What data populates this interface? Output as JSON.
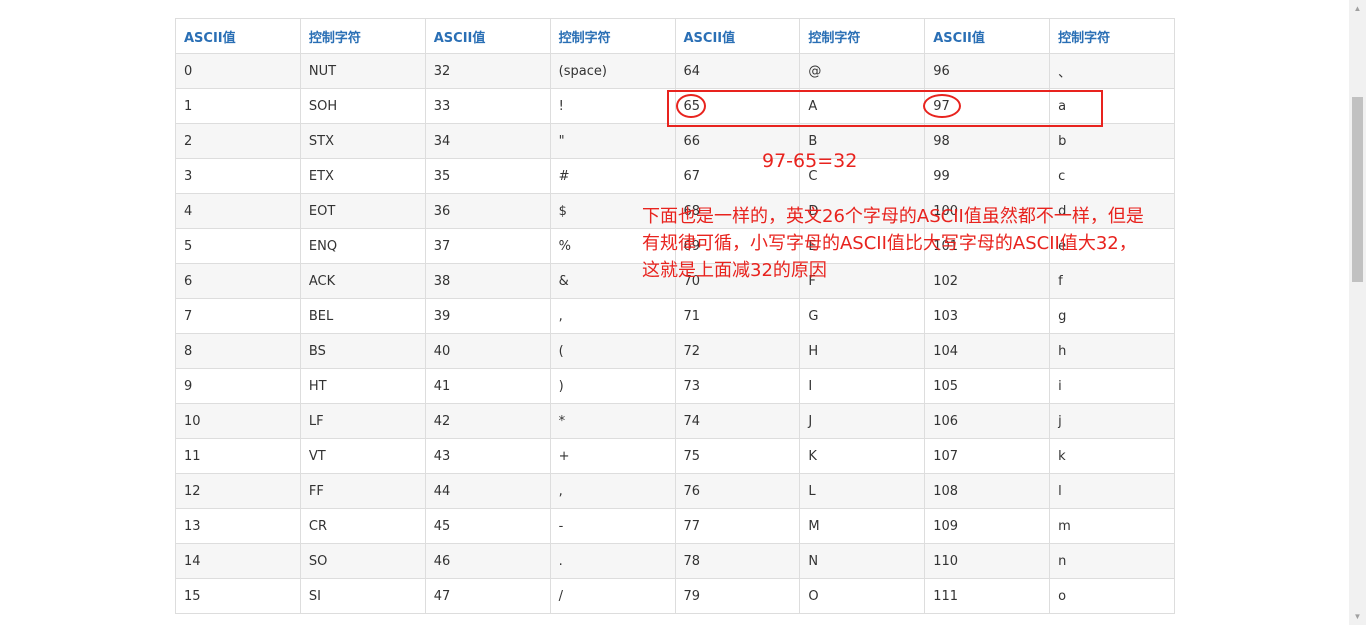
{
  "table": {
    "headers": [
      "ASCII值",
      "控制字符",
      "ASCII值",
      "控制字符",
      "ASCII值",
      "控制字符",
      "ASCII值",
      "控制字符"
    ],
    "rows": [
      [
        "0",
        "NUT",
        "32",
        "(space)",
        "64",
        "@",
        "96",
        "、"
      ],
      [
        "1",
        "SOH",
        "33",
        "!",
        "65",
        "A",
        "97",
        "a"
      ],
      [
        "2",
        "STX",
        "34",
        "\"",
        "66",
        "B",
        "98",
        "b"
      ],
      [
        "3",
        "ETX",
        "35",
        "#",
        "67",
        "C",
        "99",
        "c"
      ],
      [
        "4",
        "EOT",
        "36",
        "$",
        "68",
        "D",
        "100",
        "d"
      ],
      [
        "5",
        "ENQ",
        "37",
        "%",
        "69",
        "E",
        "101",
        "e"
      ],
      [
        "6",
        "ACK",
        "38",
        "&",
        "70",
        "F",
        "102",
        "f"
      ],
      [
        "7",
        "BEL",
        "39",
        ",",
        "71",
        "G",
        "103",
        "g"
      ],
      [
        "8",
        "BS",
        "40",
        "(",
        "72",
        "H",
        "104",
        "h"
      ],
      [
        "9",
        "HT",
        "41",
        ")",
        "73",
        "I",
        "105",
        "i"
      ],
      [
        "10",
        "LF",
        "42",
        "*",
        "74",
        "J",
        "106",
        "j"
      ],
      [
        "11",
        "VT",
        "43",
        "+",
        "75",
        "K",
        "107",
        "k"
      ],
      [
        "12",
        "FF",
        "44",
        ",",
        "76",
        "L",
        "108",
        "l"
      ],
      [
        "13",
        "CR",
        "45",
        "-",
        "77",
        "M",
        "109",
        "m"
      ],
      [
        "14",
        "SO",
        "46",
        ".",
        "78",
        "N",
        "110",
        "n"
      ],
      [
        "15",
        "SI",
        "47",
        "/",
        "79",
        "O",
        "111",
        "o"
      ]
    ]
  },
  "annotations": {
    "formula": "97-65=32",
    "description_lines": [
      "下面也是一样的，英文26个字母的ASCII值虽然都不一样，但是",
      "有规律可循，小写字母的ASCII值比大写字母的ASCII值大32，",
      "这就是上面减32的原因"
    ],
    "color": "#e8231e"
  },
  "colors": {
    "header_text": "#2a6fb5",
    "border": "#dddddd",
    "stripe": "#f6f6f6"
  },
  "scrollbar": {
    "up_icon": "▲",
    "down_icon": "▼"
  }
}
